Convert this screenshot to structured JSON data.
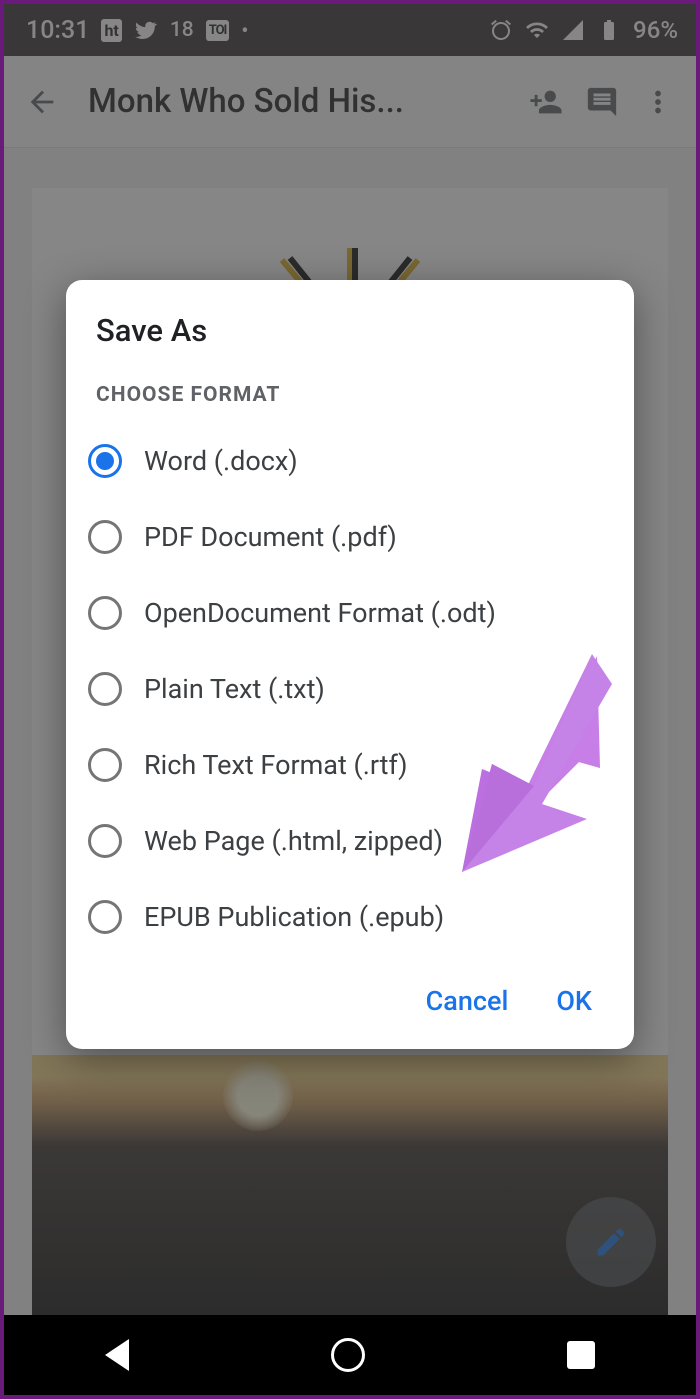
{
  "statusbar": {
    "time": "10:31",
    "notif_ht": "ht",
    "notif_count": "18",
    "notif_toi": "TOI",
    "battery_percent": "96%"
  },
  "appbar": {
    "title": "Monk Who Sold His..."
  },
  "dialog": {
    "title": "Save As",
    "subhead": "CHOOSE FORMAT",
    "options": [
      {
        "label": "Word (.docx)",
        "selected": true
      },
      {
        "label": "PDF Document (.pdf)",
        "selected": false
      },
      {
        "label": "OpenDocument Format (.odt)",
        "selected": false
      },
      {
        "label": "Plain Text (.txt)",
        "selected": false
      },
      {
        "label": "Rich Text Format (.rtf)",
        "selected": false
      },
      {
        "label": "Web Page (.html, zipped)",
        "selected": false
      },
      {
        "label": "EPUB Publication (.epub)",
        "selected": false
      }
    ],
    "cancel": "Cancel",
    "ok": "OK"
  }
}
